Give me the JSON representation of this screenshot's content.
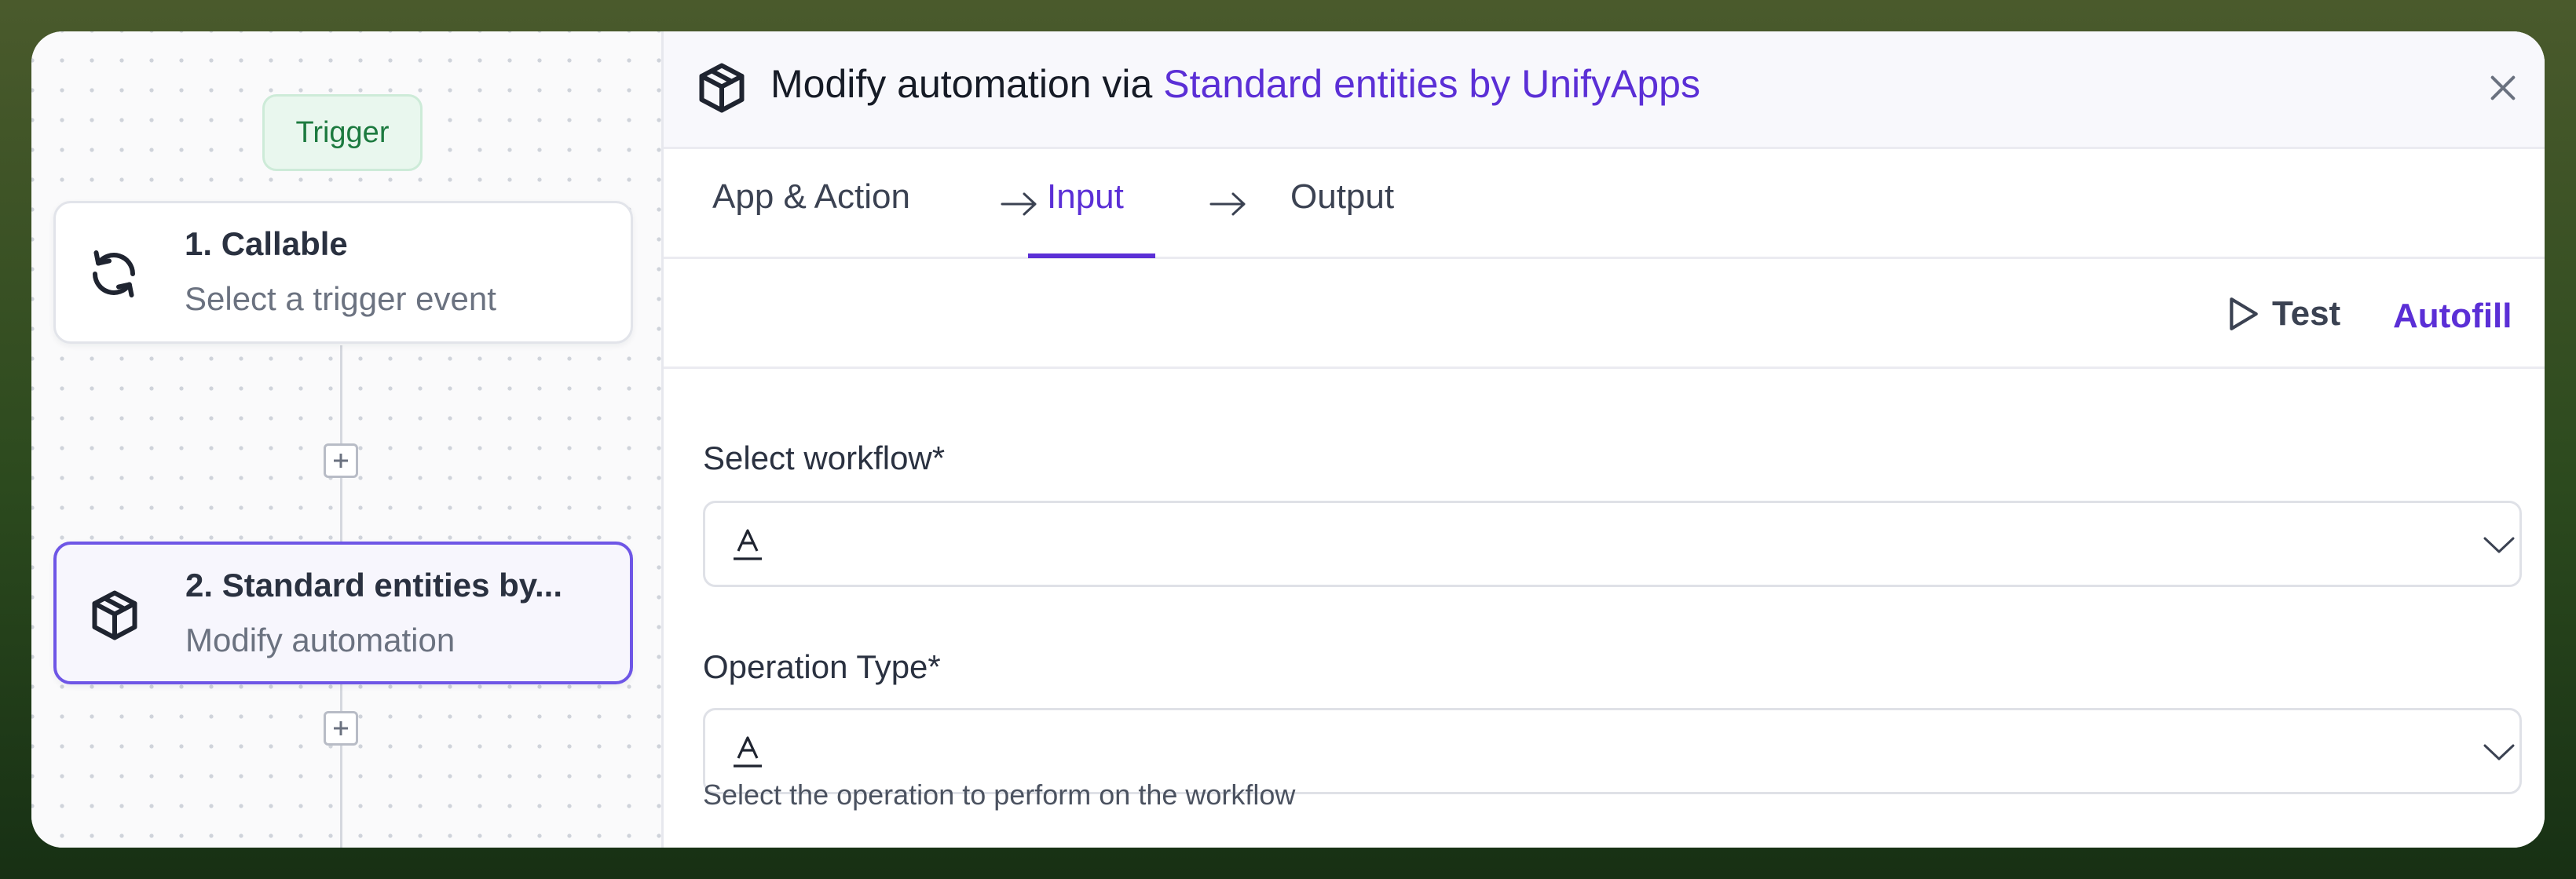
{
  "canvas": {
    "trigger_label": "Trigger",
    "nodes": [
      {
        "title": "1. Callable",
        "subtitle": "Select a trigger event",
        "icon": "sync-icon"
      },
      {
        "title": "2. Standard entities by...",
        "subtitle": "Modify automation",
        "icon": "box-icon"
      }
    ]
  },
  "panel": {
    "title_prefix": "Modify automation via ",
    "title_link": "Standard entities by UnifyApps",
    "tabs": [
      "App & Action",
      "Input",
      "Output"
    ],
    "active_tab": "Input",
    "test_label": "Test",
    "autofill_label": "Autofill",
    "fields": [
      {
        "label": "Select workflow*",
        "value": "",
        "type_icon": "text-type-icon"
      },
      {
        "label": "Operation Type*",
        "value": "",
        "type_icon": "text-type-icon",
        "help": "Select the operation to perform on the workflow"
      }
    ]
  },
  "colors": {
    "accent": "#5b2fd6",
    "trigger_bg": "#e9f7ee",
    "trigger_text": "#1c7a3f",
    "selected_border": "#6e56e6"
  }
}
